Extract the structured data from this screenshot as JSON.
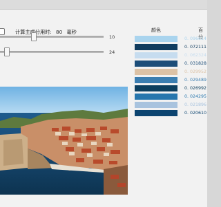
{
  "settings": {
    "time_label": "计算主成分用时:",
    "time_value": "80",
    "time_unit": "毫秒"
  },
  "sliders": [
    {
      "value": "10",
      "level": 0.3
    },
    {
      "value": "24",
      "level": 0.04
    }
  ],
  "image": {
    "description_icon": "photo-of-coastal-city"
  },
  "palette": {
    "header_color": "颜色",
    "header_percent": "百分",
    "rows": [
      {
        "color": "#a9d4ee",
        "text_color": "#a9d4ee",
        "percent": "0. 096614"
      },
      {
        "color": "#103c5f",
        "text_color": "#103c5f",
        "percent": "0. 072111"
      },
      {
        "color": "#c6dcef",
        "text_color": "#c6dcef",
        "percent": "0. 062324"
      },
      {
        "color": "#1c4d79",
        "text_color": "#1c4d79",
        "percent": "0. 031828"
      },
      {
        "color": "#dcc2a6",
        "text_color": "#dcc2a6",
        "percent": "0. 029952"
      },
      {
        "color": "#3b7eb1",
        "text_color": "#3b7eb1",
        "percent": "0. 029489"
      },
      {
        "color": "#0c3e5e",
        "text_color": "#0c3e5e",
        "percent": "0. 026992"
      },
      {
        "color": "#2776ad",
        "text_color": "#2776ad",
        "percent": "0. 024295"
      },
      {
        "color": "#a8c3de",
        "text_color": "#a8c3de",
        "percent": "0. 021896"
      },
      {
        "color": "#0c4470",
        "text_color": "#0c4470",
        "percent": "0. 020610"
      }
    ]
  }
}
